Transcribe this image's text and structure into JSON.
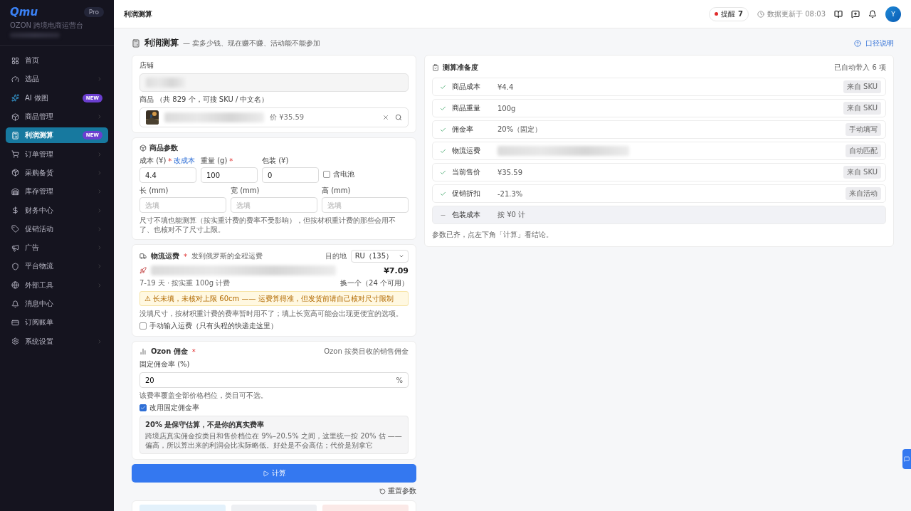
{
  "sidebar": {
    "logo": "Qmu",
    "plan": "Pro",
    "subtitle": "OZON 跨境电商运营台",
    "items": [
      {
        "label": "首页",
        "kind": "grid",
        "chevron": false,
        "selected": false
      },
      {
        "label": "选品",
        "kind": "gauge",
        "chevron": true,
        "selected": false
      },
      {
        "label": "AI 做图",
        "kind": "sparkle",
        "chevron": false,
        "badge": "NEW",
        "selected": false
      },
      {
        "label": "商品管理",
        "kind": "box",
        "chevron": true,
        "selected": false
      },
      {
        "label": "利润测算",
        "kind": "calc",
        "chevron": false,
        "badge": "NEW",
        "selected": true
      },
      {
        "label": "订单管理",
        "kind": "cart",
        "chevron": true,
        "selected": false
      },
      {
        "label": "采购备货",
        "kind": "package",
        "chevron": true,
        "selected": false
      },
      {
        "label": "库存管理",
        "kind": "warehouse",
        "chevron": true,
        "selected": false
      },
      {
        "label": "财务中心",
        "kind": "dollar",
        "chevron": true,
        "selected": false
      },
      {
        "label": "促销活动",
        "kind": "tag",
        "chevron": true,
        "selected": false
      },
      {
        "label": "广告",
        "kind": "megaphone",
        "chevron": true,
        "selected": false
      },
      {
        "label": "平台物流",
        "kind": "shield",
        "chevron": true,
        "selected": false
      },
      {
        "label": "外部工具",
        "kind": "globe",
        "chevron": true,
        "selected": false
      },
      {
        "label": "消息中心",
        "kind": "bell",
        "chevron": false,
        "selected": false
      },
      {
        "label": "订阅账单",
        "kind": "card",
        "chevron": false,
        "selected": false
      },
      {
        "label": "系统设置",
        "kind": "gear",
        "chevron": true,
        "selected": false
      }
    ]
  },
  "topbar": {
    "title": "利润测算",
    "alert_label": "提醒",
    "alert_count": "7",
    "updated": "数据更新于 08:03",
    "avatar": "Y"
  },
  "header": {
    "title": "利润测算",
    "subtitle": "— 卖多少钱、现在赚不赚、活动能不能参加",
    "help": "口径说明"
  },
  "store": {
    "label": "店铺"
  },
  "product": {
    "label": "商品",
    "hint": "（共 829 个，可搜 SKU / 中文名）",
    "price": "价 ¥35.59"
  },
  "params": {
    "title": "商品参数",
    "fields": [
      {
        "label": "成本 (¥)",
        "required_mark": "*",
        "link": "改成本",
        "value": "4.4"
      },
      {
        "label": "重量 (g)",
        "required_mark": "*",
        "value": "100"
      },
      {
        "label": "包装 (¥)",
        "value": "0"
      }
    ],
    "battery": {
      "label": "含电池",
      "checked": false
    },
    "dims": [
      {
        "label": "长 (mm)",
        "placeholder": "选填"
      },
      {
        "label": "宽 (mm)",
        "placeholder": "选填"
      },
      {
        "label": "高 (mm)",
        "placeholder": "选填"
      }
    ],
    "note": "尺寸不填也能测算（按实重计费的费率不受影响），但按材积重计费的那些会用不了、也核对不了尺寸上限。"
  },
  "logistics": {
    "title": "物流运费",
    "required_mark": "*",
    "subtitle": "发到俄罗斯的全程运费",
    "dest_label": "目的地",
    "dest": "RU（135）",
    "price": "¥7.09",
    "eta": "7-19 天 · 按实重 100g 计费",
    "switch": "换一个（24 个可用）",
    "warning": "⚠ 长未填，未核对上限 60cm —— 运费算得准，但发货前请自己核对尺寸限制",
    "note": "没填尺寸，按材积重计费的费率暂时用不了；填上长宽高可能会出现更便宜的选项。",
    "manual": {
      "label": "手动输入运费（只有头程的快递走这里）",
      "checked": false
    }
  },
  "commission": {
    "title": "Ozon 佣金",
    "required_mark": "*",
    "aside": "Ozon 按类目收的销售佣金",
    "field_label": "固定佣金率 (%)",
    "value": "20",
    "unit": "%",
    "note": "该费率覆盖全部价格档位，类目可不选。",
    "fixed": {
      "label": "改用固定佣金率",
      "checked": true
    },
    "info_title": "20% 是保守估算，不是你的真实费率",
    "info_body": "跨境店真实佣金按类目和售价档位在 9%–20.5% 之间，这里统一按 20% 估 —— 偏高，所以算出来的利润会比实际略低。好处是不会高估；代价是别拿它"
  },
  "actions": {
    "calculate": "计算",
    "reset": "重置参数"
  },
  "readiness": {
    "title": "测算准备度",
    "aside": "已自动带入 6 项",
    "rows": [
      {
        "label": "商品成本",
        "value": "¥4.4",
        "tag": "来自 SKU",
        "done": true
      },
      {
        "label": "商品重量",
        "value": "100g",
        "tag": "来自 SKU",
        "done": true
      },
      {
        "label": "佣金率",
        "value": "20%（固定）",
        "tag": "手动填写",
        "done": true
      },
      {
        "label": "物流运费",
        "tag": "自动匹配",
        "done": true
      },
      {
        "label": "当前售价",
        "value": "¥35.59",
        "tag": "来自 SKU",
        "done": true
      },
      {
        "label": "促销折扣",
        "value": "-21.3%",
        "tag": "来自活动",
        "done": true
      },
      {
        "label": "包装成本",
        "value": "按 ¥0 计",
        "done": false
      }
    ],
    "footer": "参数已齐，点左下角「计算」看结论。"
  },
  "summary_tiles": [
    {
      "color": "#e3f1fb"
    },
    {
      "color": "#eef0f3"
    },
    {
      "color": "#fbe9e7"
    }
  ]
}
